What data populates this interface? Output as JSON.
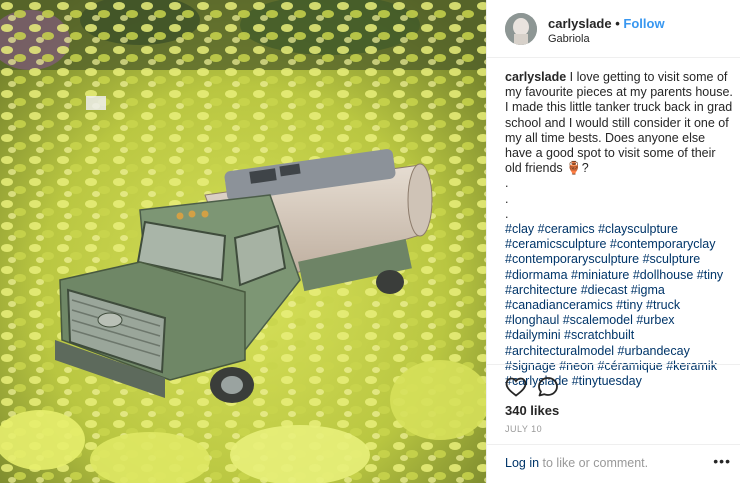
{
  "post": {
    "username": "carlyslade",
    "separator": "•",
    "follow_label": "Follow",
    "location": "Gabriola",
    "caption_user": "carlyslade",
    "caption_text": "I love getting to visit some of my favourite pieces at my parents house. I made this little tanker truck back in grad school and I would still consider it one of my all time bests. Does anyone else have a good spot to visit some of their old friends 🏺?",
    "caption_dots": [
      ".",
      ".",
      "."
    ],
    "hashtags": "#clay #ceramics #claysculpture #ceramicsculpture #contemporaryclay #contemporarysculpture #sculpture #diormama #miniature #dollhouse #tiny #architecture #diecast #igma #canadianceramics #tiny #truck #longhaul #scalemodel #urbex #dailymini #scratchbuilt #architecturalmodel #urbandecay #signage #neon #céramique #keramik #carlyslade #tinytuesday",
    "likes": "340 likes",
    "date": "JULY 10",
    "login_link": "Log in",
    "login_suffix": " to like or comment.",
    "more_label": "•••"
  },
  "icons": {
    "like": "heart-icon",
    "comment": "comment-bubble-icon",
    "more": "more-options-icon"
  },
  "colors": {
    "follow": "#3897f0",
    "hashtag": "#003569",
    "muted": "#999999",
    "text": "#262626"
  }
}
